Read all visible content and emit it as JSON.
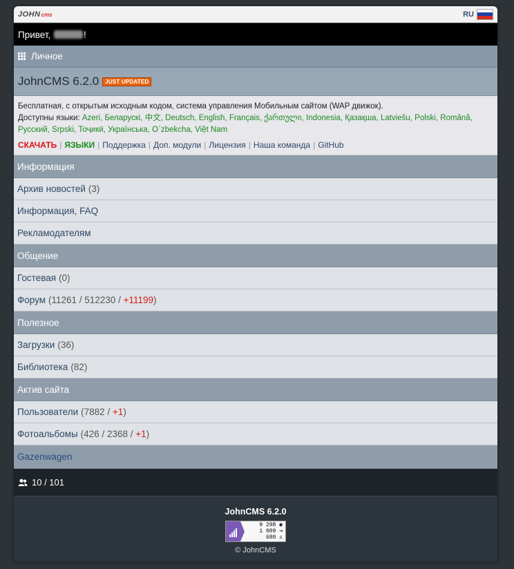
{
  "header": {
    "logo_main": "JOHN",
    "logo_sub": "cms",
    "lang_code": "RU",
    "flag_colors": [
      "#ffffff",
      "#1c3fa8",
      "#d52b1e"
    ]
  },
  "greeting": {
    "prefix": "Привет,",
    "suffix": "!"
  },
  "personal": {
    "label": "Личное"
  },
  "product": {
    "title": "JohnCMS 6.2.0",
    "badge": "JUST UPDATED",
    "description": "Бесплатная, с открытым исходным кодом, система управления Мобильным сайтом (WAP движок).",
    "languages_label": "Доступны языки:",
    "languages": "Azeri, Беларускі, 中文, Deutsch, English, Français, ქართული, Indonesia, Қазақша, Latviešu, Polski, Română, Русский, Srpski, Тоҷикӣ, Українська, O`zbekcha, Việt Nam",
    "links": {
      "download": "СКАЧАТЬ",
      "languages": "ЯЗЫКИ",
      "support": "Поддержка",
      "modules": "Доп. модули",
      "license": "Лицензия",
      "team": "Наша команда",
      "github": "GitHub"
    }
  },
  "sections": {
    "info": {
      "title": "Информация",
      "news": {
        "label": "Архив новостей",
        "count": "(3)"
      },
      "faq": {
        "label": "Информация, FAQ"
      },
      "ads": {
        "label": "Рекламодателям"
      }
    },
    "talk": {
      "title": "Общение",
      "guestbook": {
        "label": "Гостевая",
        "count": "(0)"
      },
      "forum": {
        "label": "Форум",
        "count_a": "(11261 / 512230 /",
        "count_new": "+11199",
        "count_close": ")"
      }
    },
    "useful": {
      "title": "Полезное",
      "downloads": {
        "label": "Загрузки",
        "count": "(36)"
      },
      "library": {
        "label": "Библиотека",
        "count": "(82)"
      }
    },
    "active": {
      "title": "Актив сайта",
      "users": {
        "label": "Пользователи",
        "count_a": "(7882 /",
        "count_new": "+1",
        "count_close": ")"
      },
      "albums": {
        "label": "Фотоальбомы",
        "count_a": "(426 / 2368 /",
        "count_new": "+1",
        "count_close": ")"
      }
    }
  },
  "gazenwagen": {
    "label": "Gazenwagen"
  },
  "online": {
    "text": "10 / 101"
  },
  "footer": {
    "version": "JohnCMS 6.2.0",
    "counter": {
      "line1": "9 298",
      "line2": "1 009",
      "line3": "680"
    },
    "copyright": "© JohnCMS"
  }
}
